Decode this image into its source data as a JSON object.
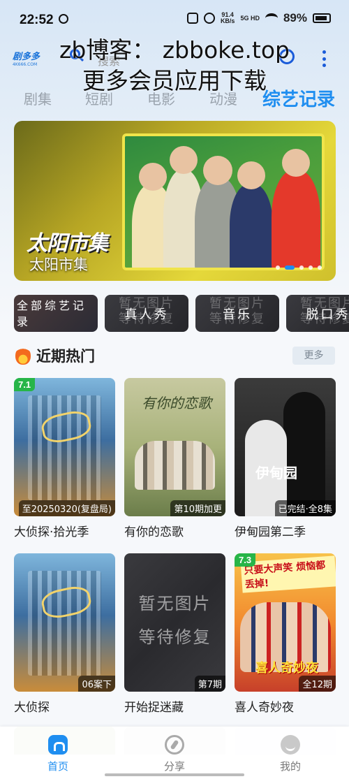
{
  "status_bar": {
    "time": "22:52",
    "net_speed": "91.4",
    "net_unit": "KB/s",
    "signal": "5G HD",
    "battery": "89%"
  },
  "header": {
    "logo_main": "剧多多",
    "logo_sub": "4K666.COM",
    "search_placeholder": "搜索",
    "watermark_line1": "zb博客： zbboke.top",
    "watermark_line2": "更多会员应用下载"
  },
  "tabs": [
    {
      "label": "剧集"
    },
    {
      "label": "短剧"
    },
    {
      "label": "电影"
    },
    {
      "label": "动漫"
    },
    {
      "label": "综艺记录"
    }
  ],
  "banner": {
    "logo_text": "太阳市集",
    "title": "太阳市集",
    "page_count": 5,
    "active_page": 2
  },
  "chips": {
    "placeholder_line1": "暂无图片",
    "placeholder_line2": "等待修复",
    "items": [
      {
        "label": "全部综艺记录"
      },
      {
        "label": "真人秀"
      },
      {
        "label": "音乐"
      },
      {
        "label": "脱口秀"
      }
    ]
  },
  "hot": {
    "title": "近期热门",
    "more": "更多",
    "items": [
      {
        "title": "大侦探·拾光季",
        "score": "7.1",
        "episode": "至20250320(复盘局)"
      },
      {
        "title": "有你的恋歌",
        "score": "",
        "episode": "第10期加更",
        "poster_text": "有你的恋歌"
      },
      {
        "title": "伊甸园第二季",
        "score": "",
        "episode": "已完结·全8集",
        "poster_text": "伊甸园"
      },
      {
        "title": "大侦探",
        "score": "",
        "episode": "06案下"
      },
      {
        "title": "开始捉迷藏",
        "score": "",
        "episode": "第7期",
        "placeholder_line1": "暂无图片",
        "placeholder_line2": "等待修复"
      },
      {
        "title": "喜人奇妙夜",
        "score": "7.3",
        "episode": "全12期",
        "poster_header": "只要大声笑 烦恼都丢掉!",
        "poster_text": "喜人奇妙夜"
      }
    ]
  },
  "bottom_nav": [
    {
      "label": "首页",
      "icon": "home-icon",
      "active": true
    },
    {
      "label": "分享",
      "icon": "compass-icon",
      "active": false
    },
    {
      "label": "我的",
      "icon": "face-icon",
      "active": false
    }
  ],
  "colors": {
    "accent": "#1f8ef0",
    "score_badge": "#27b548"
  }
}
